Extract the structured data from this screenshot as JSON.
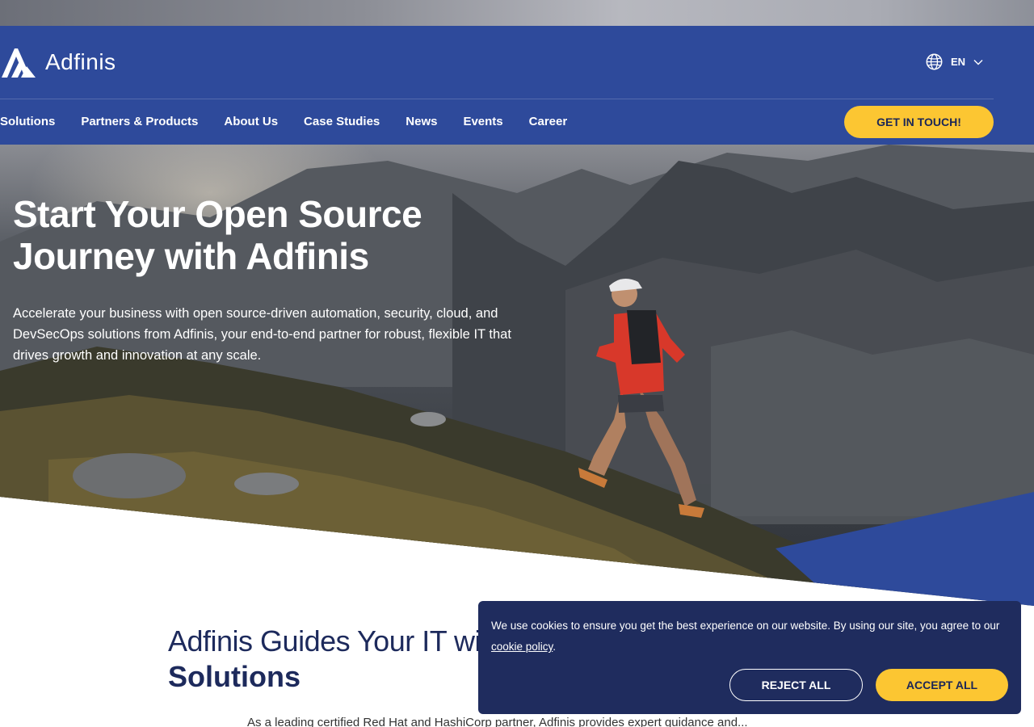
{
  "brand": {
    "name": "Adfinis",
    "primary_color": "#2e4a9b",
    "accent_color": "#fcc632",
    "dark_color": "#1f2c5e"
  },
  "header": {
    "language": "EN",
    "nav": [
      {
        "label": "Solutions"
      },
      {
        "label": "Partners & Products"
      },
      {
        "label": "About Us"
      },
      {
        "label": "Case Studies"
      },
      {
        "label": "News"
      },
      {
        "label": "Events"
      },
      {
        "label": "Career"
      }
    ],
    "cta_label": "GET IN TOUCH!"
  },
  "hero": {
    "title": "Start Your Open Source Journey with Adfinis",
    "description": "Accelerate your business with open source-driven automation, security, cloud, and DevSecOps solutions from Adfinis, your end-to-end partner for robust, flexible IT that drives growth and innovation at any scale."
  },
  "section": {
    "title_line1": "Adfinis Guides Your IT with Open Source",
    "title_line2": "Solutions",
    "text": "As a leading certified Red Hat and HashiCorp partner, Adfinis provides expert guidance and..."
  },
  "cookie_banner": {
    "text": "We use cookies to ensure you get the best experience on our website. By using our site, you agree to our",
    "link_label": "cookie policy",
    "link_suffix": ".",
    "reject_label": "REJECT ALL",
    "accept_label": "ACCEPT ALL"
  },
  "icons": {
    "logo": "adfinis-logo-icon",
    "language": "globe-icon",
    "dropdown": "chevron-down-icon"
  }
}
